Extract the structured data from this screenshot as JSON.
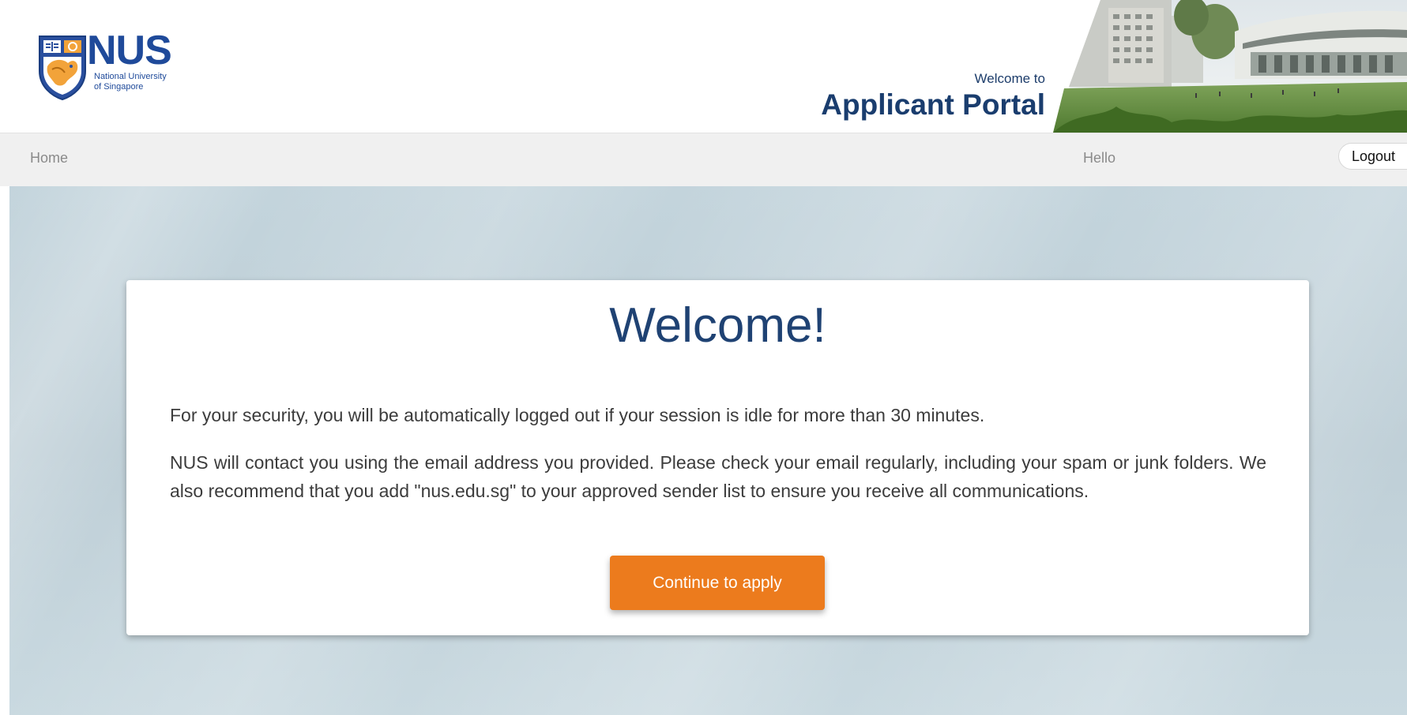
{
  "header": {
    "logo": {
      "wordmark": "NUS",
      "subline_1": "National University",
      "subline_2": "of Singapore"
    },
    "welcome_to": "Welcome to",
    "portal_name": "Applicant Portal",
    "banner_image": "campus-photo"
  },
  "nav": {
    "home_label": "Home",
    "greeting": "Hello",
    "logout_label": "Logout"
  },
  "main": {
    "title": "Welcome!",
    "paragraph_1": "For your security, you will be automatically logged out if your session is idle for more than 30 minutes.",
    "paragraph_2": "NUS will contact you using the email address you provided. Please check your email regularly, including your spam or junk folders. We also recommend that you add \"nus.edu.sg\" to your approved sender list to ensure you receive all communications.",
    "continue_label": "Continue to apply"
  },
  "colors": {
    "brand_blue": "#1f4a9a",
    "title_blue": "#1f4273",
    "accent_orange": "#ec7b1d",
    "nav_bg": "#f0f0f0",
    "main_bg": "#c3d4dc"
  }
}
